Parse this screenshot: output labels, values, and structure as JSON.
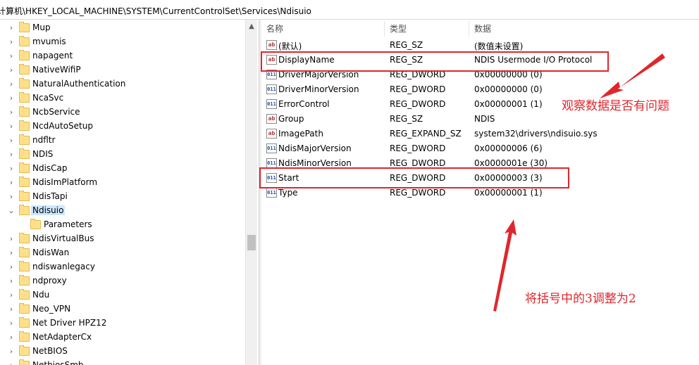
{
  "address": {
    "path": "计算机\\HKEY_LOCAL_MACHINE\\SYSTEM\\CurrentControlSet\\Services\\Ndisuio"
  },
  "tree": {
    "items": [
      {
        "label": "Mup",
        "expander": "›",
        "selected": false,
        "child": false
      },
      {
        "label": "mvumis",
        "expander": "›",
        "selected": false,
        "child": false
      },
      {
        "label": "napagent",
        "expander": "›",
        "selected": false,
        "child": false
      },
      {
        "label": "NativeWifiP",
        "expander": "›",
        "selected": false,
        "child": false
      },
      {
        "label": "NaturalAuthentication",
        "expander": "›",
        "selected": false,
        "child": false
      },
      {
        "label": "NcaSvc",
        "expander": "›",
        "selected": false,
        "child": false
      },
      {
        "label": "NcbService",
        "expander": "›",
        "selected": false,
        "child": false
      },
      {
        "label": "NcdAutoSetup",
        "expander": "›",
        "selected": false,
        "child": false
      },
      {
        "label": "ndfltr",
        "expander": "›",
        "selected": false,
        "child": false
      },
      {
        "label": "NDIS",
        "expander": "›",
        "selected": false,
        "child": false
      },
      {
        "label": "NdisCap",
        "expander": "›",
        "selected": false,
        "child": false
      },
      {
        "label": "NdisImPlatform",
        "expander": "›",
        "selected": false,
        "child": false
      },
      {
        "label": "NdisTapi",
        "expander": "›",
        "selected": false,
        "child": false
      },
      {
        "label": "Ndisuio",
        "expander": "⌄",
        "selected": true,
        "child": false
      },
      {
        "label": "Parameters",
        "expander": "",
        "selected": false,
        "child": true
      },
      {
        "label": "NdisVirtualBus",
        "expander": "›",
        "selected": false,
        "child": false
      },
      {
        "label": "NdisWan",
        "expander": "›",
        "selected": false,
        "child": false
      },
      {
        "label": "ndiswanlegacy",
        "expander": "›",
        "selected": false,
        "child": false
      },
      {
        "label": "ndproxy",
        "expander": "›",
        "selected": false,
        "child": false
      },
      {
        "label": "Ndu",
        "expander": "›",
        "selected": false,
        "child": false
      },
      {
        "label": "Neo_VPN",
        "expander": "›",
        "selected": false,
        "child": false
      },
      {
        "label": "Net Driver HPZ12",
        "expander": "›",
        "selected": false,
        "child": false
      },
      {
        "label": "NetAdapterCx",
        "expander": "›",
        "selected": false,
        "child": false
      },
      {
        "label": "NetBIOS",
        "expander": "›",
        "selected": false,
        "child": false
      },
      {
        "label": "NetbiosSmb",
        "expander": "›",
        "selected": false,
        "child": false
      }
    ]
  },
  "scrollbar": {
    "up_glyph": "▲"
  },
  "values": {
    "headers": {
      "name": "名称",
      "type": "类型",
      "data": "数据"
    },
    "rows": [
      {
        "icon": "ab",
        "kind": "string",
        "name": "(默认)",
        "type": "REG_SZ",
        "data": "(数值未设置)"
      },
      {
        "icon": "ab",
        "kind": "string",
        "name": "DisplayName",
        "type": "REG_SZ",
        "data": "NDIS Usermode I/O Protocol"
      },
      {
        "icon": "011",
        "kind": "dword",
        "name": "DriverMajorVersion",
        "type": "REG_DWORD",
        "data": "0x00000000 (0)"
      },
      {
        "icon": "011",
        "kind": "dword",
        "name": "DriverMinorVersion",
        "type": "REG_DWORD",
        "data": "0x00000000 (0)"
      },
      {
        "icon": "011",
        "kind": "dword",
        "name": "ErrorControl",
        "type": "REG_DWORD",
        "data": "0x00000001 (1)"
      },
      {
        "icon": "ab",
        "kind": "string",
        "name": "Group",
        "type": "REG_SZ",
        "data": "NDIS"
      },
      {
        "icon": "ab",
        "kind": "string",
        "name": "ImagePath",
        "type": "REG_EXPAND_SZ",
        "data": "system32\\drivers\\ndisuio.sys"
      },
      {
        "icon": "011",
        "kind": "dword",
        "name": "NdisMajorVersion",
        "type": "REG_DWORD",
        "data": "0x00000006 (6)"
      },
      {
        "icon": "011",
        "kind": "dword",
        "name": "NdisMinorVersion",
        "type": "REG_DWORD",
        "data": "0x0000001e (30)"
      },
      {
        "icon": "011",
        "kind": "dword",
        "name": "Start",
        "type": "REG_DWORD",
        "data": "0x00000003 (3)"
      },
      {
        "icon": "011",
        "kind": "dword",
        "name": "Type",
        "type": "REG_DWORD",
        "data": "0x00000001 (1)"
      }
    ]
  },
  "annotations": {
    "check_note": "观察数据是否有问题",
    "change_note": "将括号中的3调整为2",
    "color": "#e0262c"
  }
}
